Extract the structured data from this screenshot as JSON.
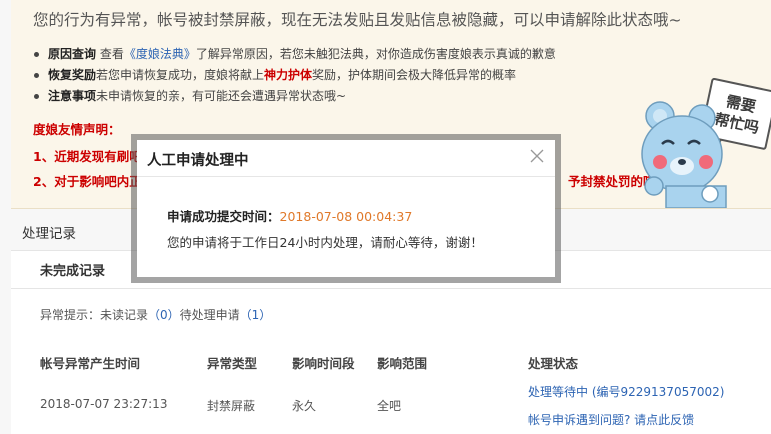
{
  "notice": {
    "title": "您的行为有异常，帐号被封禁屏蔽，现在无法发贴且发贴信息被隐藏，可以申请解除此状态哦~",
    "items": [
      {
        "label": "原因查询",
        "pre": " 查看",
        "link": "《度娘法典》",
        "post": "了解异常原因，若您未触犯法典，对你造成伤害度娘表示真诚的歉意"
      },
      {
        "label": "恢复奖励",
        "pre": "若您申请恢复成功，度娘将献上",
        "highlight": "神力护体",
        "post": "奖励，护体期间会极大降低异常的概率"
      },
      {
        "label": "注意事项",
        "pre": "未申请恢复的亲，有可能还会遭遇异常状态哦~"
      }
    ],
    "declaration_title": "度娘友情声明：",
    "declaration_1": "1、近期发现有刷吧",
    "declaration_2": "2、对于影响吧内正",
    "declaration_2_tail": "予封禁处罚的哦~"
  },
  "mascot": {
    "sign_line1": "需要",
    "sign_line2": "帮忙吗",
    "icon": "bear-mascot-icon"
  },
  "records": {
    "heading": "处理记录",
    "tab": "未完成记录",
    "hint_prefix": "异常提示：未读记录",
    "unread_count": "（0）",
    "hint_middle": "待处理申请",
    "pending_count": "（1）",
    "columns": [
      "帐号异常产生时间",
      "异常类型",
      "影响时间段",
      "影响范围",
      "处理状态"
    ],
    "row": {
      "time": "2018-07-07 23:27:13",
      "type": "封禁屏蔽",
      "duration": "永久",
      "scope": "全吧",
      "status": "处理等待中 (编号9229137057002)",
      "appeal_link": "帐号申诉遇到问题? 请点此反馈"
    }
  },
  "modal": {
    "title": "人工申请处理中",
    "label": "申请成功提交时间：",
    "time": "2018-07-08 00:04:37",
    "message": "您的申请将于工作日24小时内处理，请耐心等待，谢谢！"
  }
}
